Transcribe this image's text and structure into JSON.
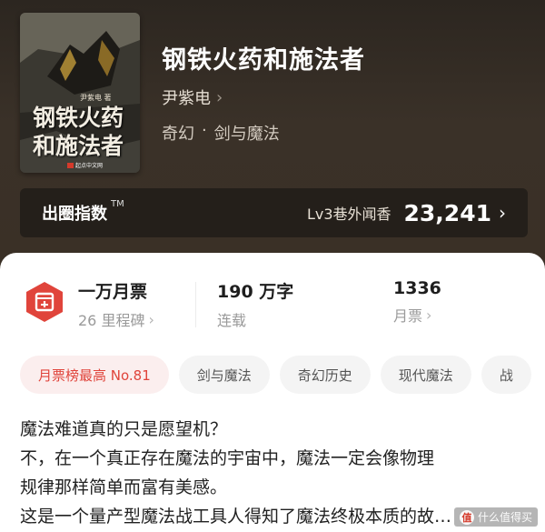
{
  "book": {
    "title": "钢铁火药和施法者",
    "author": "尹紫电",
    "author_chevron": "›",
    "genre": "奇幻",
    "genre_separator": "·",
    "subgenre": "剑与魔法",
    "cover": {
      "author": "尹紫电 著",
      "title_line1": "钢铁火药",
      "title_line2": "和施法者",
      "publisher": "起点中文网"
    }
  },
  "fan_index": {
    "label": "出圈指数",
    "trademark": "TM",
    "level": "Lv3巷外闻香",
    "score": "23,241",
    "chevron": "›"
  },
  "stats": {
    "monthly_ticket": {
      "value": "一万月票",
      "sub": "26 里程碑",
      "chevron": "›"
    },
    "word_count": {
      "value": "190 万字",
      "sub": "连载"
    },
    "tickets": {
      "value": "1336",
      "sub": "月票",
      "chevron": "›"
    }
  },
  "tags": [
    "月票榜最高 No.81",
    "剑与魔法",
    "奇幻历史",
    "现代魔法",
    "战"
  ],
  "description": [
    "魔法难道真的只是愿望机？",
    "不，在一个真正存在魔法的宇宙中，魔法一定会像物理",
    "规律那样简单而富有美感。",
    "这是一个量产型魔法战工具人得知了魔法终极本质的故…"
  ],
  "watermark": {
    "mark": "值",
    "text": "什么值得买"
  },
  "colors": {
    "accent_red": "#e0443b",
    "hero_bg": "#2c2620",
    "panel_bg": "#ffffff"
  }
}
